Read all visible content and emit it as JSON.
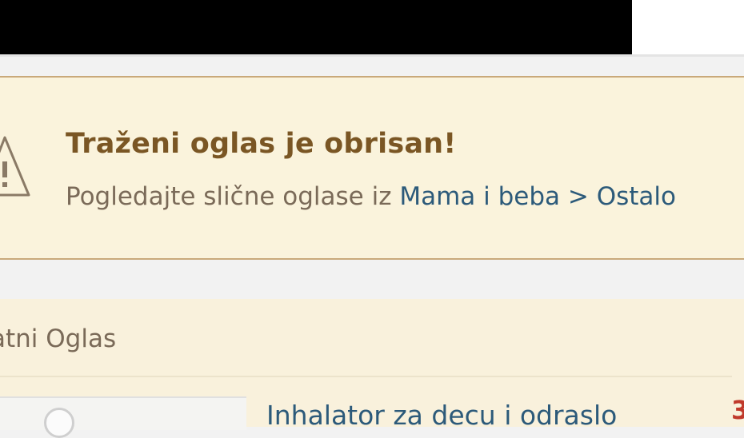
{
  "notice": {
    "title": "Traženi oglas je obrisan!",
    "text_prefix": "Pogledajte slične oglase iz",
    "category_link": "Mama i beba > Ostalo",
    "icon": "warning-triangle-icon"
  },
  "listing_section": {
    "title": "atni Oglas"
  },
  "item": {
    "title": "Inhalator za decu i odraslo",
    "price": "3"
  },
  "colors": {
    "notice_bg": "#faf3dc",
    "notice_border": "#c9a97a",
    "title_color": "#7a5624",
    "link_color": "#2c5a7a",
    "price_color": "#c0392b"
  }
}
